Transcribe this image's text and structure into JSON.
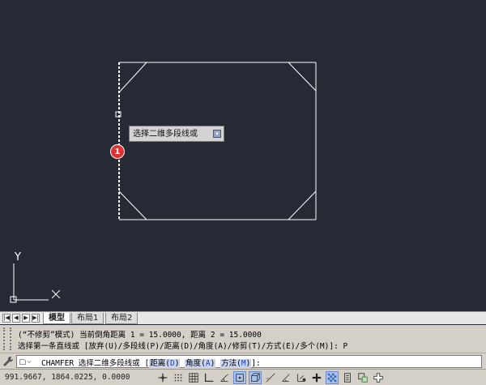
{
  "tooltip": {
    "text": "选择二维多段线或",
    "dropdown_glyph": "▾"
  },
  "badge": {
    "number": "1"
  },
  "axes": {
    "y_label": "Y",
    "x_label": "X"
  },
  "tabs": {
    "nav": [
      "|◀",
      "◀",
      "▶",
      "▶|"
    ],
    "items": [
      {
        "label": "模型",
        "active": true
      },
      {
        "label": "布局1",
        "active": false
      },
      {
        "label": "布局2",
        "active": false
      }
    ]
  },
  "command_history": {
    "line1": "(“不修剪”模式) 当前倒角距离 1 = 15.0000, 距离 2 = 15.0000",
    "line2": "选择第一条直线或 [放弃(U)/多段线(P)/距离(D)/角度(A)/修剪(T)/方式(E)/多个(M)]: P"
  },
  "command_line": {
    "prefix": "CHAMFER 选择二维多段线或 [",
    "options": [
      {
        "label": "距离",
        "key": "D"
      },
      {
        "label": "角度",
        "key": "A"
      },
      {
        "label": "方法",
        "key": "M"
      }
    ],
    "suffix": "]:"
  },
  "status": {
    "coordinates": "991.9667,  1864.0225, 0.0000"
  },
  "colors": {
    "canvas_bg": "#252a34",
    "geometry": "#ffffff",
    "badge": "#e03131",
    "toggle_on": "#a9c3ee"
  }
}
